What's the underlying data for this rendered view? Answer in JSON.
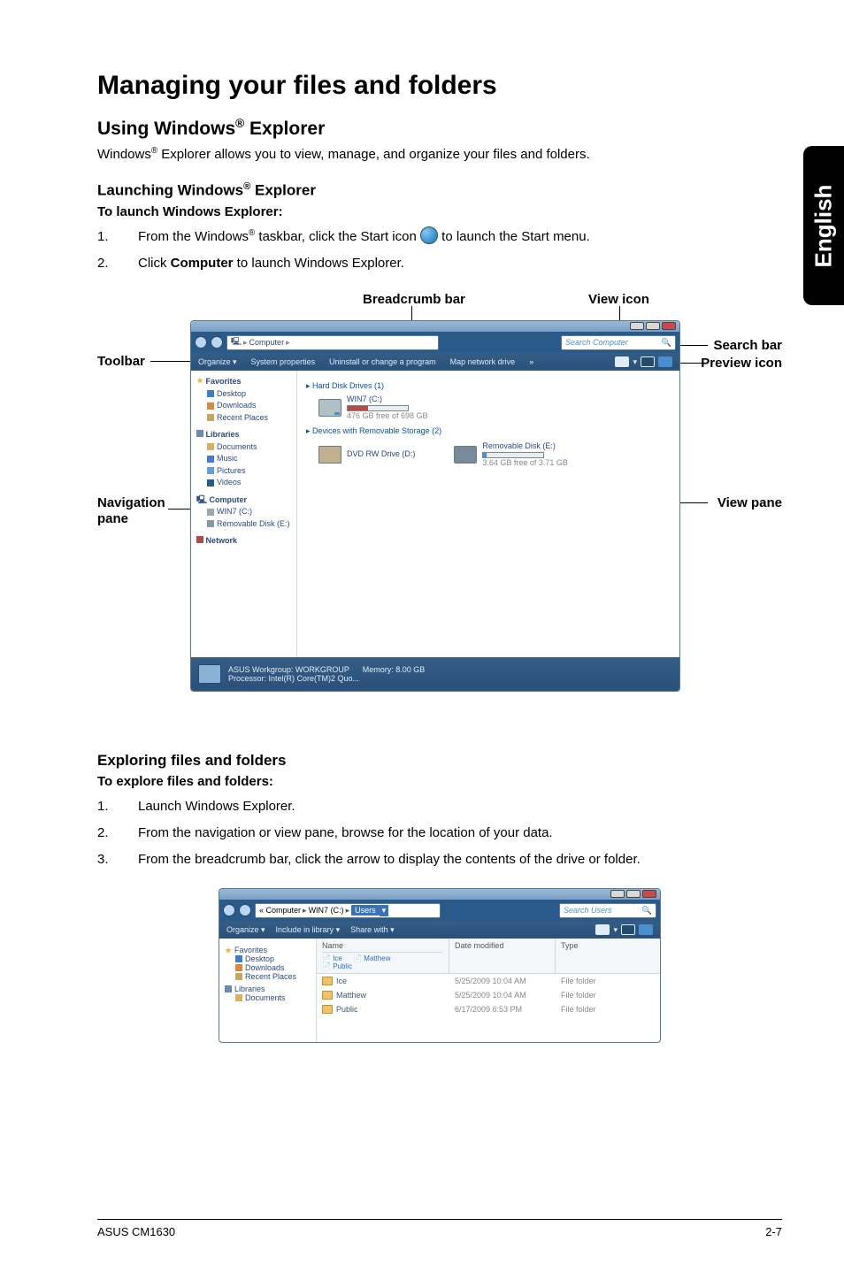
{
  "sideTab": "English",
  "h1": "Managing your files and folders",
  "sec1": {
    "h2_pre": "Using Windows",
    "h2_sup": "®",
    "h2_post": " Explorer",
    "p_pre": "Windows",
    "p_sup": "®",
    "p_post": " Explorer allows you to view, manage, and organize your files and folders."
  },
  "sec2": {
    "h3_pre": "Launching Windows",
    "h3_sup": "®",
    "h3_post": " Explorer",
    "lead": "To launch Windows Explorer:",
    "step1_num": "1.",
    "step1_a": "From the Windows",
    "step1_sup": "®",
    "step1_b": " taskbar, click the Start icon ",
    "step1_c": " to launch the Start menu.",
    "step2_num": "2.",
    "step2_a": "Click ",
    "step2_bold": "Computer",
    "step2_b": " to launch Windows Explorer."
  },
  "diagram": {
    "breadcrumb": "Breadcrumb bar",
    "viewicon": "View icon",
    "toolbar": "Toolbar",
    "searchbar": "Search bar",
    "preview": "Preview icon",
    "nav": "Navigation pane",
    "viewpane": "View pane"
  },
  "win1": {
    "crumb_icon": "▸",
    "crumb_text": "Computer",
    "crumb_arrow": "▸",
    "search": "Search Computer",
    "tb_organize": "Organize ▾",
    "tb_sys": "System properties",
    "tb_uninstall": "Uninstall or change a program",
    "tb_map": "Map network drive",
    "tb_more": "»",
    "nav_fav": "Favorites",
    "nav_desktop": "Desktop",
    "nav_downloads": "Downloads",
    "nav_recent": "Recent Places",
    "nav_lib": "Libraries",
    "nav_docs": "Documents",
    "nav_music": "Music",
    "nav_pics": "Pictures",
    "nav_videos": "Videos",
    "nav_comp": "Computer",
    "nav_c": "WIN7 (C:)",
    "nav_e": "Removable Disk (E:)",
    "nav_net": "Network",
    "sect_hdd": "▸ Hard Disk Drives (1)",
    "drive_c": "WIN7 (C:)",
    "drive_c_sub": "476 GB free of 698 GB",
    "sect_dev": "▸ Devices with Removable Storage (2)",
    "drive_dvd": "DVD RW Drive (D:)",
    "drive_usb": "Removable Disk (E:)",
    "drive_usb_sub": "3.64 GB free of 3.71 GB",
    "status_main": "ASUS Workgroup: WORKGROUP",
    "status_mem": "Memory: 8.00 GB",
    "status_proc": "Processor: Intel(R) Core(TM)2 Quo..."
  },
  "sec3": {
    "h3": "Exploring files and folders",
    "lead": "To explore files and folders:",
    "step1_num": "1.",
    "step1": "Launch Windows Explorer.",
    "step2_num": "2.",
    "step2": "From the navigation or view pane, browse for the location of your data.",
    "step3_num": "3.",
    "step3": "From the breadcrumb bar, click the arrow to display the contents of the drive or folder."
  },
  "win2": {
    "crumb1": "« Computer",
    "crumb2": "WIN7 (C:)",
    "crumb3": "Users",
    "search": "Search Users",
    "tb_organize": "Organize ▾",
    "tb_include": "Include in library ▾",
    "tb_share": "Share with ▾",
    "col_name": "Name",
    "col_date": "Date modified",
    "col_type": "Type",
    "sub_ice": "Ice",
    "sub_matthew": "Matthew",
    "sub_public": "Public",
    "nav_fav": "Favorites",
    "nav_desktop": "Desktop",
    "nav_downloads": "Downloads",
    "nav_recent": "Recent Places",
    "nav_lib": "Libraries",
    "nav_docs": "Documents",
    "rows": [
      {
        "name": "Ice",
        "date": "5/25/2009 10:04 AM",
        "type": "File folder"
      },
      {
        "name": "Matthew",
        "date": "5/25/2009 10:04 AM",
        "type": "File folder"
      },
      {
        "name": "Public",
        "date": "6/17/2009 6:53 PM",
        "type": "File folder"
      }
    ]
  },
  "footer": {
    "left": "ASUS CM1630",
    "right": "2-7"
  }
}
